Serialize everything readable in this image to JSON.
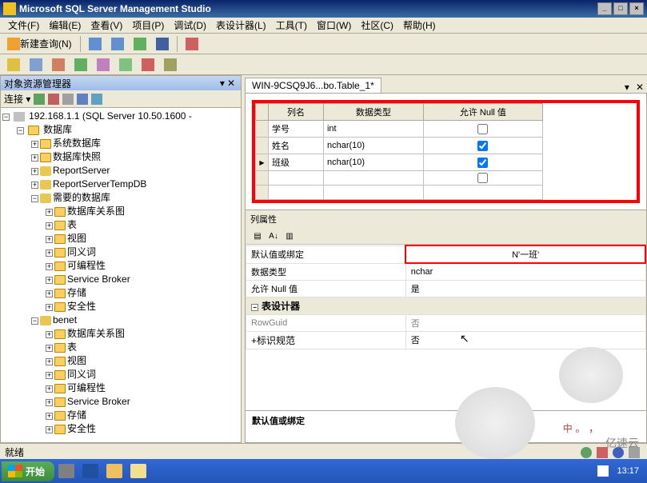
{
  "window": {
    "title": "Microsoft SQL Server Management Studio"
  },
  "menu": {
    "file": "文件(F)",
    "edit": "编辑(E)",
    "view": "查看(V)",
    "project": "项目(P)",
    "debug": "调试(D)",
    "designer": "表设计器(L)",
    "tools": "工具(T)",
    "window": "窗口(W)",
    "community": "社区(C)",
    "help": "帮助(H)"
  },
  "toolbar": {
    "new_query": "新建查询(N)"
  },
  "object_explorer": {
    "title": "对象资源管理器",
    "connect_label": "连接 ▾",
    "server": "192.168.1.1 (SQL Server 10.50.1600 -",
    "databases": "数据库",
    "sys_db": "系统数据库",
    "snapshot": "数据库快照",
    "report_server": "ReportServer",
    "report_server_temp": "ReportServerTempDB",
    "needed_db": "需要的数据库",
    "benet_db": "benet",
    "diagram": "数据库关系图",
    "tables": "表",
    "views": "视图",
    "synonyms": "同义词",
    "programmability": "可编程性",
    "service_broker": "Service Broker",
    "storage": "存储",
    "security": "安全性"
  },
  "tab": {
    "title": "WIN-9CSQ9J6...bo.Table_1*"
  },
  "columns": {
    "header_name": "列名",
    "header_type": "数据类型",
    "header_null": "允许 Null 值",
    "rows": [
      {
        "name": "学号",
        "type": "int",
        "allow_null": false
      },
      {
        "name": "姓名",
        "type": "nchar(10)",
        "allow_null": true
      },
      {
        "name": "班级",
        "type": "nchar(10)",
        "allow_null": true
      }
    ]
  },
  "props": {
    "panel_title": "列属性",
    "default_binding": "默认值或绑定",
    "default_binding_val": "N'一班'",
    "data_type": "数据类型",
    "data_type_val": "nchar",
    "allow_null": "允许 Null 值",
    "allow_null_val": "是",
    "designer_cat": "表设计器",
    "rowguid": "RowGuid",
    "rowguid_val": "否",
    "identity": "标识规范",
    "identity_val": "否",
    "desc_title": "默认值或绑定"
  },
  "status": {
    "ready": "就绪",
    "ime": "中"
  },
  "taskbar": {
    "start": "开始",
    "time": "13:17"
  },
  "watermark": "亿速云"
}
